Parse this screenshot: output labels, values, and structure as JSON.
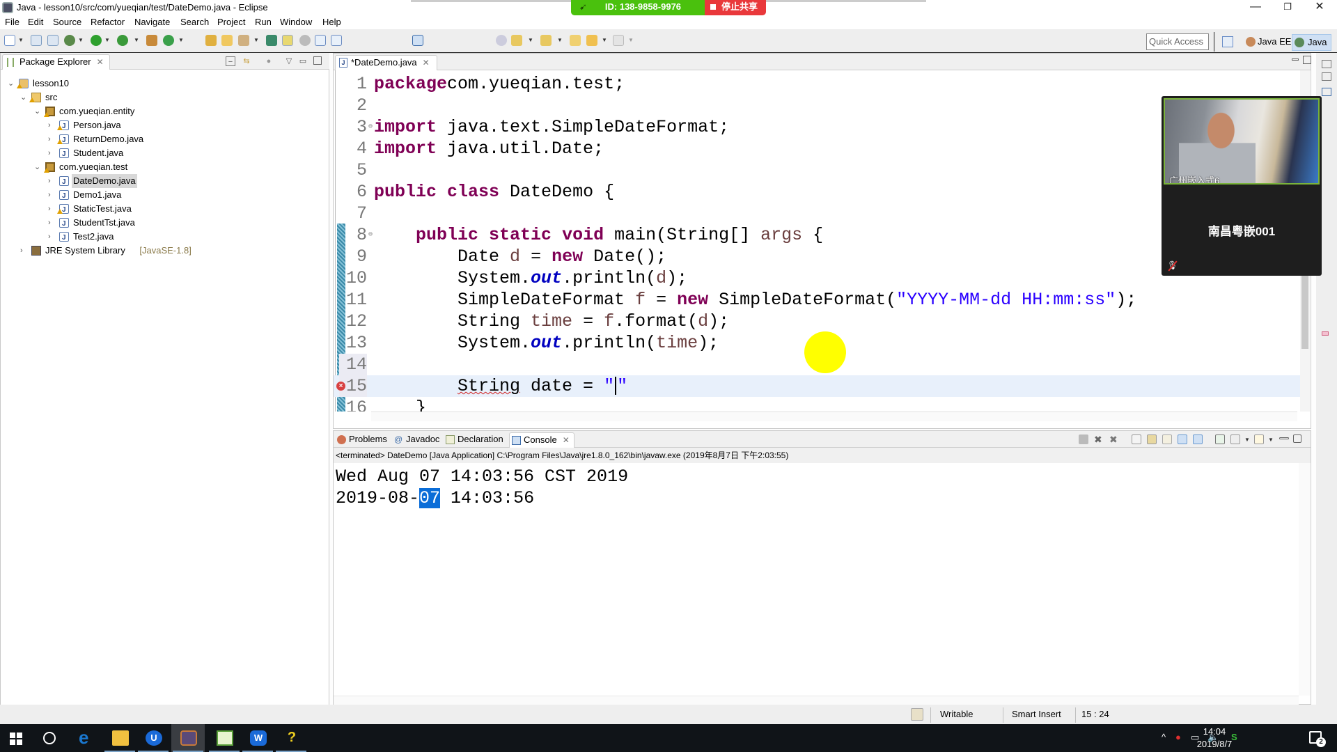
{
  "window": {
    "title": "Java - lesson10/src/com/yueqian/test/DateDemo.java - Eclipse",
    "controls": {
      "minimize": "—",
      "maximize": "❐",
      "close": "✕"
    }
  },
  "screen_share": {
    "id_label": "ID: 138-9858-9976",
    "stop_label": "停止共享",
    "colors": {
      "id_bg": "#4ac10d",
      "stop_bg": "#e9383b"
    }
  },
  "menu": [
    "File",
    "Edit",
    "Source",
    "Refactor",
    "Navigate",
    "Search",
    "Project",
    "Run",
    "Window",
    "Help"
  ],
  "toolbar": {
    "quick_access_placeholder": "Quick Access",
    "perspectives": [
      {
        "label": "Java EE",
        "active": false
      },
      {
        "label": "Java",
        "active": true
      }
    ]
  },
  "package_explorer": {
    "title": "Package Explorer",
    "tree": [
      {
        "label": "lesson10",
        "type": "project",
        "depth": 0,
        "expanded": true,
        "warning": true
      },
      {
        "label": "src",
        "type": "src",
        "depth": 1,
        "expanded": true,
        "warning": true
      },
      {
        "label": "com.yueqian.entity",
        "type": "package",
        "depth": 2,
        "expanded": true,
        "warning": true
      },
      {
        "label": "Person.java",
        "type": "java",
        "depth": 3,
        "expanded": false,
        "warning": true
      },
      {
        "label": "ReturnDemo.java",
        "type": "java",
        "depth": 3,
        "expanded": false,
        "warning": true
      },
      {
        "label": "Student.java",
        "type": "java",
        "depth": 3,
        "expanded": false,
        "warning": false
      },
      {
        "label": "com.yueqian.test",
        "type": "package",
        "depth": 2,
        "expanded": true,
        "warning": true
      },
      {
        "label": "DateDemo.java",
        "type": "java",
        "depth": 3,
        "expanded": false,
        "warning": false,
        "selected": true
      },
      {
        "label": "Demo1.java",
        "type": "java",
        "depth": 3,
        "expanded": false,
        "warning": false
      },
      {
        "label": "StaticTest.java",
        "type": "java",
        "depth": 3,
        "expanded": false,
        "warning": true
      },
      {
        "label": "StudentTst.java",
        "type": "java",
        "depth": 3,
        "expanded": false,
        "warning": false
      },
      {
        "label": "Test2.java",
        "type": "java",
        "depth": 3,
        "expanded": false,
        "warning": false
      },
      {
        "label": "JRE System Library",
        "type": "library",
        "depth": 1,
        "expanded": false,
        "warning": false,
        "suffix": "[JavaSE-1.8]"
      }
    ]
  },
  "editor": {
    "tab_label": "*DateDemo.java",
    "dirty": true,
    "lines": [
      {
        "n": "1",
        "tokens": [
          [
            "kw",
            "package"
          ],
          [
            "",
            "com.yueqian.test;"
          ]
        ]
      },
      {
        "n": "2",
        "tokens": []
      },
      {
        "n": "3",
        "fold": true,
        "tokens": [
          [
            "kw",
            "import"
          ],
          [
            "",
            " java.text.SimpleDateFormat;"
          ]
        ]
      },
      {
        "n": "4",
        "tokens": [
          [
            "kw",
            "import"
          ],
          [
            "",
            " java.util.Date;"
          ]
        ]
      },
      {
        "n": "5",
        "tokens": []
      },
      {
        "n": "6",
        "tokens": [
          [
            "kw",
            "public"
          ],
          [
            "",
            " "
          ],
          [
            "kw",
            "class"
          ],
          [
            "",
            " DateDemo {"
          ]
        ]
      },
      {
        "n": "7",
        "tokens": []
      },
      {
        "n": "8",
        "fold": true,
        "tokens": [
          [
            "",
            "    "
          ],
          [
            "kw",
            "public"
          ],
          [
            "",
            " "
          ],
          [
            "kw",
            "static"
          ],
          [
            "",
            " "
          ],
          [
            "kw",
            "void"
          ],
          [
            "",
            " main(String[] "
          ],
          [
            "var",
            "args"
          ],
          [
            "",
            " {"
          ]
        ]
      },
      {
        "n": "9",
        "tokens": [
          [
            "",
            "        Date "
          ],
          [
            "var",
            "d"
          ],
          [
            "",
            " = "
          ],
          [
            "kw",
            "new"
          ],
          [
            "",
            " Date();"
          ]
        ]
      },
      {
        "n": "10",
        "tokens": [
          [
            "",
            "        System."
          ],
          [
            "fld",
            "out"
          ],
          [
            "",
            ".println("
          ],
          [
            "var",
            "d"
          ],
          [
            "",
            ");"
          ]
        ]
      },
      {
        "n": "11",
        "tokens": [
          [
            "",
            "        SimpleDateFormat "
          ],
          [
            "var",
            "f"
          ],
          [
            "",
            " = "
          ],
          [
            "kw",
            "new"
          ],
          [
            "",
            " SimpleDateFormat("
          ],
          [
            "str",
            "\"YYYY-MM-dd HH:mm:ss\""
          ],
          [
            "",
            ");"
          ]
        ]
      },
      {
        "n": "12",
        "tokens": [
          [
            "",
            "        String "
          ],
          [
            "var",
            "time"
          ],
          [
            "",
            " = "
          ],
          [
            "var",
            "f"
          ],
          [
            "",
            ".format("
          ],
          [
            "var",
            "d"
          ],
          [
            "",
            ");"
          ]
        ]
      },
      {
        "n": "13",
        "tokens": [
          [
            "",
            "        System."
          ],
          [
            "fld",
            "out"
          ],
          [
            "",
            ".println("
          ],
          [
            "var",
            "time"
          ],
          [
            "",
            ");"
          ]
        ]
      },
      {
        "n": "14",
        "tokens": []
      },
      {
        "n": "15",
        "current": true,
        "error": true,
        "tokens": [
          [
            "",
            "        "
          ],
          [
            "err",
            "String"
          ],
          [
            "",
            " date = "
          ],
          [
            "str",
            "\""
          ],
          [
            "caret",
            ""
          ],
          [
            "str",
            "\""
          ]
        ]
      },
      {
        "n": "16",
        "tokens": [
          [
            "",
            "    }"
          ]
        ]
      }
    ]
  },
  "video_call": {
    "video_label": "广州嵌入式6",
    "participant_name": "南昌粤嵌001",
    "mic_muted": true
  },
  "console": {
    "tabs": [
      {
        "label": "Problems",
        "active": false
      },
      {
        "label": "Javadoc",
        "active": false
      },
      {
        "label": "Declaration",
        "active": false
      },
      {
        "label": "Console",
        "active": true
      }
    ],
    "header": "<terminated> DateDemo [Java Application] C:\\Program Files\\Java\\jre1.8.0_162\\bin\\javaw.exe (2019年8月7日 下午2:03:55)",
    "output": [
      {
        "before": "Wed Aug 07 14:03:56 CST 2019",
        "selected": "",
        "after": ""
      },
      {
        "before": "2019-08-",
        "selected": "07",
        "after": " 14:03:56"
      }
    ]
  },
  "status_bar": {
    "writable": "Writable",
    "insert_mode": "Smart Insert",
    "position": "15 : 24"
  },
  "taskbar": {
    "apps": [
      "edge",
      "file-explorer",
      "u-app",
      "eclipse-ide",
      "notepad-plus",
      "wps-office",
      "help-app"
    ],
    "active_app": "eclipse-ide",
    "clock_time": "14:04",
    "clock_date": "2019/8/7",
    "notification_count": "2"
  }
}
